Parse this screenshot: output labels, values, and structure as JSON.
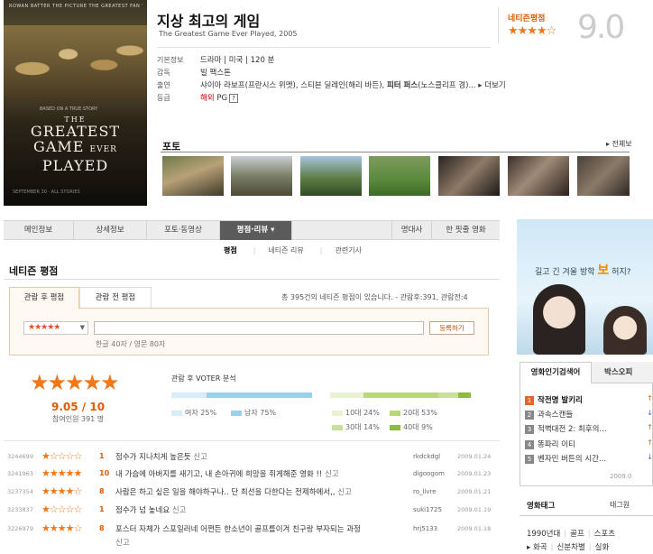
{
  "poster": {
    "credits_line": "ROWAN BATTER THE PICTURE THE GREATEST FAN WARNER",
    "tagline": "BASED ON A TRUE STORY",
    "title_the": "THE",
    "title_line1": "GREATEST",
    "title_line2": "GAME",
    "title_ever": "EVER",
    "title_line3": "PLAYED",
    "bottom_text": "SEPTEMBER 30 · ALL STORIES"
  },
  "movie": {
    "title_kr": "지상 최고의 게임",
    "title_en": "The Greatest Game Ever Played, 2005",
    "info": {
      "basic_label": "기본정보",
      "basic_value": "드라마 | 미국 | 120 분",
      "director_label": "감독",
      "director_value": "빌 팩스톤",
      "cast_label": "출연",
      "cast_value_1": "샤이아 라보프(프란시스 위멧), 스티븐 딜레인(해리 바든), ",
      "cast_value_bold": "피터 퍼스",
      "cast_value_2": "(노스클리프 경)... ",
      "cast_more": "▸ 더보기",
      "grade_label": "등급",
      "grade_region": "해외",
      "grade_value": " PG",
      "grade_q": "?"
    }
  },
  "rating": {
    "label": "네티즌평점",
    "stars": "★★★★☆",
    "big_score": "9.0"
  },
  "photo": {
    "label": "포토",
    "view_all": "▸ 전체보"
  },
  "tabs": [
    {
      "label": "메인정보"
    },
    {
      "label": "상세정보"
    },
    {
      "label": "포토·동영상"
    },
    {
      "label": "평점·리뷰 ▾"
    },
    {
      "label": "명대사"
    },
    {
      "label": "한 핏줄 영화"
    }
  ],
  "subtabs": {
    "reviews": "평점",
    "netizen_review": "네티즌 리뷰",
    "articles": "관련기사"
  },
  "section": {
    "title": "네티즌 평점",
    "tab_after": "관람 후 평점",
    "tab_before": "관람 전 평점",
    "count_text": "총 395건의 네티즌 평점이 있습니다. - 관람후:391, 관람전:4",
    "star_select": "★★★★★",
    "input_value": "",
    "submit": "등록하기",
    "char_limit": "한글 40자 / 영문 80자"
  },
  "summary": {
    "stars": "★★★★★",
    "score": "9.05 / 10",
    "people": "참여인원 391 명",
    "voter_title": "관람 후 VOTER 분석",
    "gender": {
      "female_label": "여자 25%",
      "male_label": "남자 75%",
      "female_pct": 25,
      "male_pct": 75
    },
    "age": {
      "teen_label": "10대 24%",
      "twenties_label": "20대 53%",
      "thirties_label": "30대 14%",
      "forties_label": "40대 9%",
      "teen_pct": 24,
      "twenties_pct": 53,
      "thirties_pct": 14,
      "forties_pct": 9
    },
    "colors": {
      "female": "#d6edf7",
      "male": "#9ad0ec",
      "teen": "#e9f2d2",
      "twenties": "#b9d67a",
      "thirties": "#c8e09c",
      "forties": "#8dbb3c"
    }
  },
  "reviews": [
    {
      "id": "3244699",
      "stars": "★☆☆☆☆",
      "score": "1",
      "text": "점수가 지나치게 높은듯",
      "report": " 신고",
      "user": "rkdckdgl",
      "date": "2009.01.24"
    },
    {
      "id": "3241963",
      "stars": "★★★★★",
      "score": "10",
      "text": "내 가슴에 아버지를 새기고, 내 손아귀에 희망을 쥐게해준 영화 !!",
      "report": " 신고",
      "user": "digoogom",
      "date": "2009.01.23"
    },
    {
      "id": "3237354",
      "stars": "★★★★☆",
      "score": "8",
      "text": "사람은 하고 싶은 일을 해야하구나.. 단 최선을 다한다는 전제하에서,,",
      "report": " 신고",
      "user": "ro_livre",
      "date": "2009.01.21"
    },
    {
      "id": "3233837",
      "stars": "★☆☆☆☆",
      "score": "1",
      "text": "점수가 넘 높네요",
      "report": " 신고",
      "user": "suki1725",
      "date": "2009.01.19"
    },
    {
      "id": "3226979",
      "stars": "★★★★☆",
      "score": "8",
      "text": "포스터 자체가 스포일러네 어쩐든 한소년이 골프를이겨 친구랑 부자되는 과정",
      "report": "신고",
      "user": "hrj5133",
      "date": "2009.01.18"
    }
  ],
  "ad": {
    "text_1": "길고 긴 겨울 방학 ",
    "text_bold": "보",
    "text_2": " 허지?"
  },
  "ranking": {
    "tab_search": "영화인기검색어",
    "tab_boxoffice": "박스오피",
    "items": [
      {
        "rank": "1",
        "title": "작전명 발키리",
        "arrow": "↑",
        "dir": "up"
      },
      {
        "rank": "2",
        "title": "과속스캔들",
        "arrow": "↓",
        "dir": "down"
      },
      {
        "rank": "3",
        "title": "적벽대전 2: 최후의...",
        "arrow": "↑",
        "dir": "up"
      },
      {
        "rank": "4",
        "title": "똥파리 이티",
        "arrow": "↑",
        "dir": "up"
      },
      {
        "rank": "5",
        "title": "벤자민 버튼의 시간...",
        "arrow": "↓",
        "dir": "down"
      }
    ],
    "date": "2009.0"
  },
  "movie_tags": {
    "title": "영화태그",
    "other": "태그원",
    "row1": [
      "1990년대",
      "골프",
      "스포츠"
    ],
    "row2": [
      "▸ 화곡",
      "신분차별",
      "실화"
    ]
  }
}
